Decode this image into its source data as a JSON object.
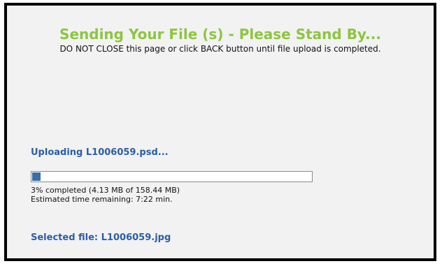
{
  "colors": {
    "title": "#8cc63f",
    "link_blue": "#2a5ea6",
    "progress_fill": "#3a6ea5"
  },
  "dialog": {
    "title": "Sending Your File (s) - Please Stand By...",
    "warning": "DO NOT CLOSE this page or click BACK button until file upload is completed."
  },
  "upload": {
    "uploading_label": "Uploading L1006059.psd...",
    "progress_percent": 3,
    "completed_text": "3% completed (4.13 MB of 158.44 MB)",
    "time_remaining_text": "Estimated time remaining: 7:22 min.",
    "selected_file_text": "Selected file: L1006059.jpg"
  }
}
